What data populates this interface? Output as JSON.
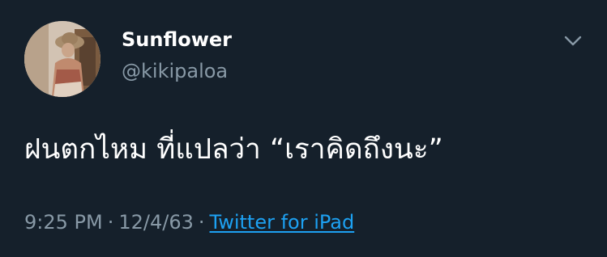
{
  "user": {
    "display_name": "Sunflower",
    "handle": "@kikipaloa"
  },
  "tweet": {
    "text": "ฝนตกไหม ที่แปลว่า “เราคิดถึงนะ”",
    "time": "9:25 PM",
    "date": "12/4/63",
    "separator": "·",
    "source": "Twitter for iPad"
  },
  "icons": {
    "menu": "chevron-down-icon",
    "avatar": "profile-photo"
  },
  "colors": {
    "background": "#15202b",
    "text": "#ffffff",
    "secondary": "#8899a6",
    "link": "#1da1f2"
  }
}
